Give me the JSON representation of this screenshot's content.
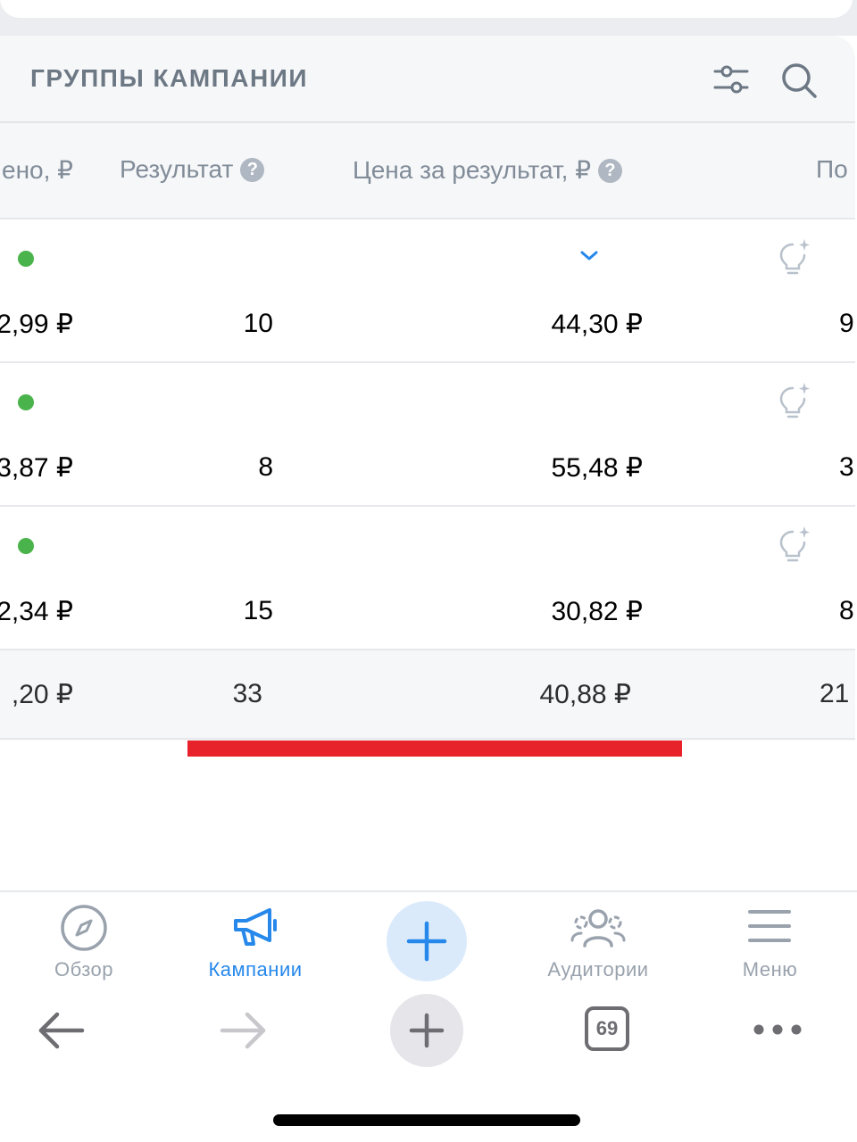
{
  "header": {
    "title": "ГРУППЫ КАМПАНИИ"
  },
  "columns": {
    "spent": "ено, ₽",
    "result": "Результат",
    "price": "Цена за результат, ₽",
    "more": "По",
    "help_glyph": "?"
  },
  "rows": [
    {
      "status": "active",
      "spent": "2,99 ₽",
      "result": "10",
      "price": "44,30 ₽",
      "more": "9"
    },
    {
      "status": "active",
      "spent": "3,87 ₽",
      "result": "8",
      "price": "55,48 ₽",
      "more": "3"
    },
    {
      "status": "active",
      "spent": "2,34 ₽",
      "result": "15",
      "price": "30,82 ₽",
      "more": "8"
    }
  ],
  "totals": {
    "spent": ",20 ₽",
    "result": "33",
    "price": "40,88 ₽",
    "more": "21"
  },
  "tabbar": {
    "items": [
      {
        "label": "Обзор",
        "icon": "compass-icon"
      },
      {
        "label": "Кампании",
        "icon": "megaphone-icon",
        "active": true
      },
      {
        "label": "",
        "icon": "plus-icon"
      },
      {
        "label": "Аудитории",
        "icon": "users-icon"
      },
      {
        "label": "Меню",
        "icon": "menu-icon"
      }
    ]
  },
  "browser": {
    "tab_count": "69"
  },
  "colors": {
    "accent": "#2688eb",
    "status_active": "#4bb34b",
    "annotation_red": "#e8222b",
    "muted_text": "#818c99"
  }
}
